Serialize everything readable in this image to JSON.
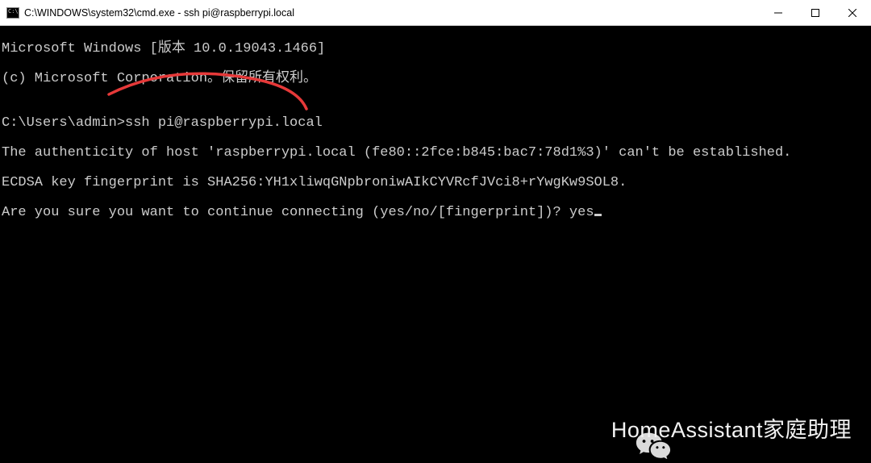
{
  "window": {
    "title": "C:\\WINDOWS\\system32\\cmd.exe - ssh  pi@raspberrypi.local"
  },
  "terminal": {
    "line1": "Microsoft Windows [版本 10.0.19043.1466]",
    "line2": "(c) Microsoft Corporation。保留所有权利。",
    "blank1": "",
    "prompt_line": "C:\\Users\\admin>ssh pi@raspberrypi.local",
    "auth_line": "The authenticity of host 'raspberrypi.local (fe80::2fce:b845:bac7:78d1%3)' can't be established.",
    "key_line": "ECDSA key fingerprint is SHA256:YH1xliwqGNpbroniwAIkCYVRcfJVci8+rYwgKw9SOL8.",
    "confirm_line": "Are you sure you want to continue connecting (yes/no/[fingerprint])? yes"
  },
  "watermark": {
    "text": "HomeAssistant家庭助理"
  },
  "colors": {
    "annotation_red": "#e63939"
  }
}
